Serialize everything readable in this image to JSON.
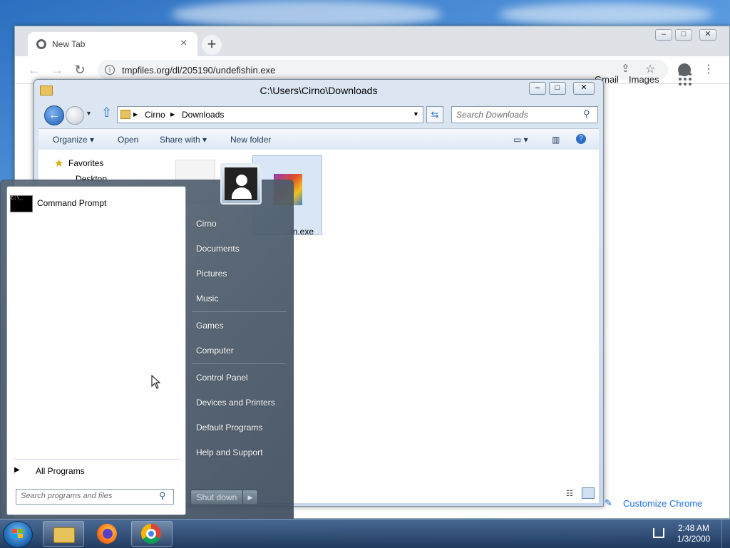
{
  "chrome": {
    "tab_title": "New Tab",
    "tab_close": "×",
    "new_tab": "+",
    "url": "tmpfiles.org/dl/205190/undefishin.exe",
    "links": {
      "gmail": "Gmail",
      "images": "Images"
    },
    "customize_label": "Customize Chrome"
  },
  "explorer": {
    "title": "C:\\Users\\Cirno\\Downloads",
    "breadcrumb": [
      "Cirno",
      "Downloads"
    ],
    "search_placeholder": "Search Downloads",
    "commands": {
      "organize": "Organize ▾",
      "open": "Open",
      "share": "Share with ▾",
      "new_folder": "New folder"
    },
    "nav": {
      "favorites": "Favorites",
      "desktop": "Desktop"
    },
    "file_label": "in.exe"
  },
  "startmenu": {
    "pinned": "Command Prompt",
    "all_programs": "All Programs",
    "search_placeholder": "Search programs and files",
    "right_items": [
      "Cirno",
      "Documents",
      "Pictures",
      "Music",
      "Games",
      "Computer",
      "Control Panel",
      "Devices and Printers",
      "Default Programs",
      "Help and Support"
    ],
    "shutdown": "Shut down"
  },
  "taskbar": {
    "time": "2:48 AM",
    "date": "1/3/2000"
  }
}
